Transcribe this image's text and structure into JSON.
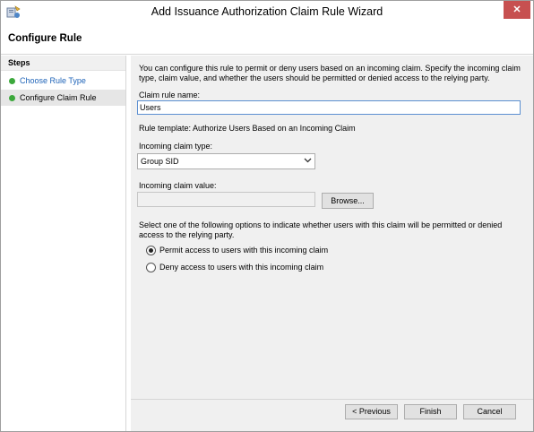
{
  "window": {
    "title": "Add Issuance Authorization Claim Rule Wizard",
    "icon": "wizard-app-icon",
    "close_label": "✕"
  },
  "header": {
    "title": "Configure Rule"
  },
  "sidebar": {
    "heading": "Steps",
    "items": [
      {
        "label": "Choose Rule Type",
        "status": "complete",
        "link": true
      },
      {
        "label": "Configure Claim Rule",
        "status": "current",
        "link": false
      }
    ]
  },
  "main": {
    "description": "You can configure this rule to permit or deny users based on an incoming claim. Specify the incoming claim type, claim value, and whether the users should be permitted or denied access to the relying party.",
    "claim_rule_name_label": "Claim rule name:",
    "claim_rule_name_value": "Users",
    "rule_template": "Rule template: Authorize Users Based on an Incoming Claim",
    "incoming_claim_type_label": "Incoming claim type:",
    "incoming_claim_type_value": "Group SID",
    "incoming_claim_value_label": "Incoming claim value:",
    "incoming_claim_value": "",
    "browse_label": "Browse...",
    "options_text": "Select one of the following options to indicate whether users with this claim will be permitted or denied access to the relying party.",
    "options": [
      {
        "label": "Permit access to users with this incoming claim",
        "selected": true
      },
      {
        "label": "Deny access to users with this incoming claim",
        "selected": false
      }
    ]
  },
  "footer": {
    "previous_label": "< Previous",
    "finish_label": "Finish",
    "cancel_label": "Cancel"
  },
  "colors": {
    "accent_border": "#5b8fd1",
    "link": "#1e63b8",
    "step_dot": "#3ca83c",
    "close_button": "#c75050",
    "panel_bg": "#f0f0f0"
  }
}
